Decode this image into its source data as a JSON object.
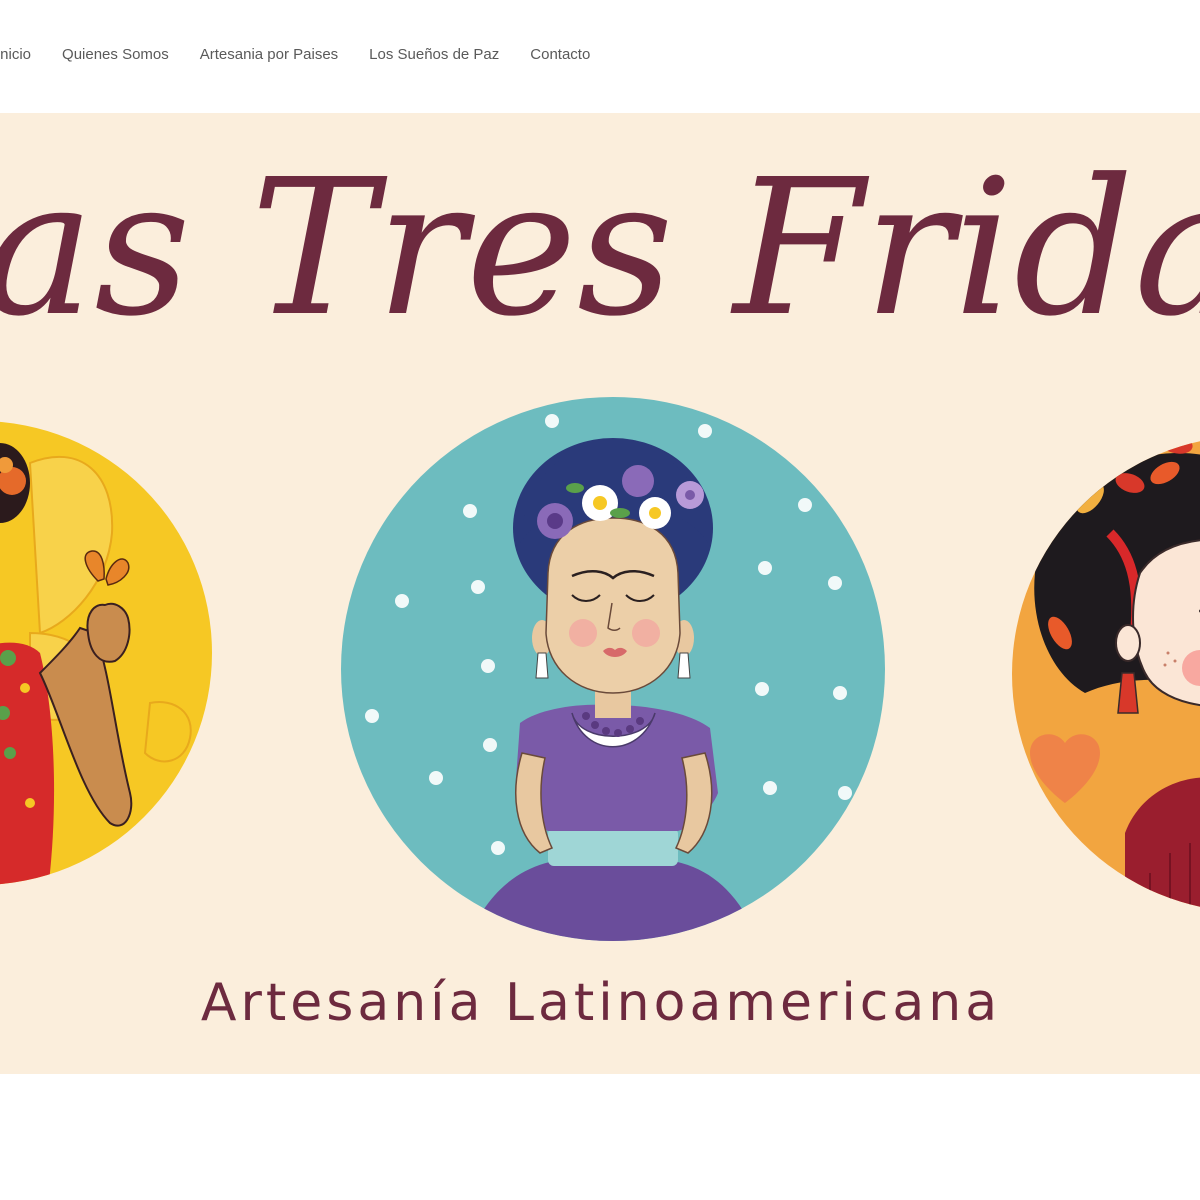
{
  "nav": {
    "items": [
      {
        "label": "Inicio"
      },
      {
        "label": "Quienes Somos"
      },
      {
        "label": "Artesania por Paises"
      },
      {
        "label": "Los Sueños de Paz"
      },
      {
        "label": "Contacto"
      }
    ]
  },
  "hero": {
    "title": "Las Tres Fridas",
    "subtitle": "Artesanía Latinoamericana"
  },
  "colors": {
    "nav_text": "#5a5a5a",
    "hero_background": "#fbeedc",
    "brand_maroon": "#6d2a3f",
    "circle_yellow": "#f6c824",
    "circle_teal": "#6dbcbf",
    "circle_orange": "#f2a540"
  }
}
